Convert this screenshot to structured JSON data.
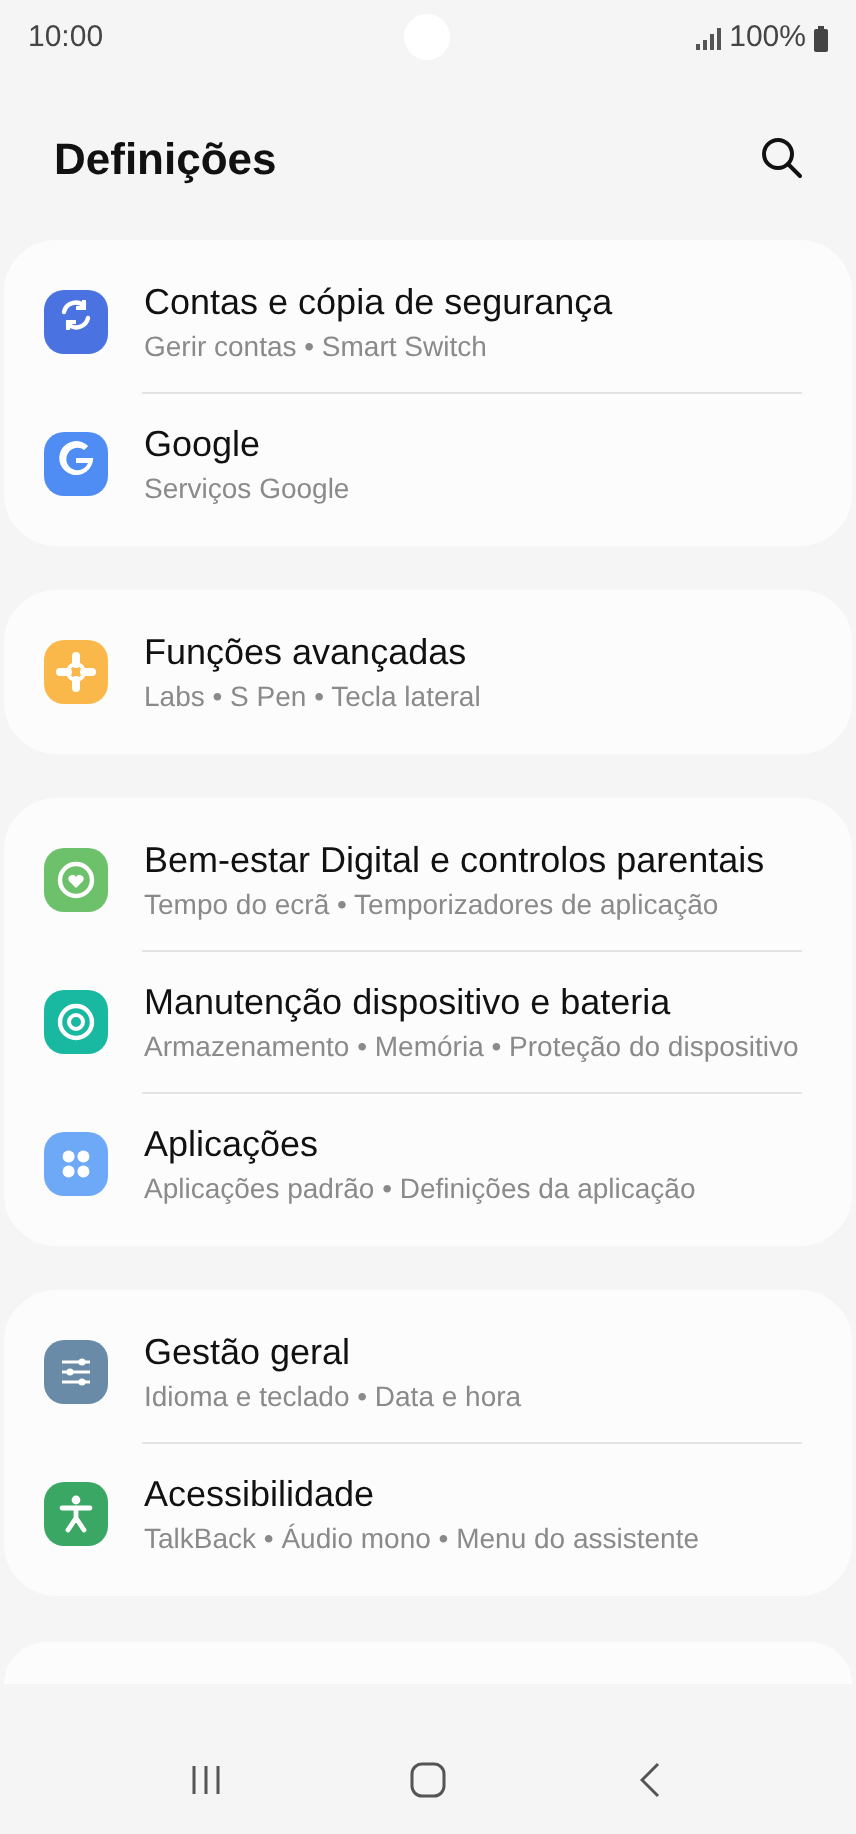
{
  "status_bar": {
    "time": "10:00",
    "battery": "100%"
  },
  "header": {
    "title": "Definições"
  },
  "groups": [
    {
      "items": [
        {
          "title": "Contas e cópia de segurança",
          "subtitle": "Gerir contas  •  Smart Switch",
          "color": "#4a72e0"
        },
        {
          "title": "Google",
          "subtitle": "Serviços Google",
          "color": "#4f8df5"
        }
      ]
    },
    {
      "items": [
        {
          "title": "Funções avançadas",
          "subtitle": "Labs  •  S Pen  •  Tecla lateral",
          "color": "#fbb84a"
        }
      ]
    },
    {
      "items": [
        {
          "title": "Bem-estar Digital e controlos parentais",
          "subtitle": "Tempo do ecrã  •  Temporizadores de aplicação",
          "color": "#6cc16a"
        },
        {
          "title": "Manutenção dispositivo e bateria",
          "subtitle": "Armazenamento  •  Memória  •  Proteção do dispositivo",
          "color": "#19b8a0"
        },
        {
          "title": "Aplicações",
          "subtitle": "Aplicações padrão  •  Definições da aplicação",
          "color": "#6ea9f7"
        }
      ]
    },
    {
      "items": [
        {
          "title": "Gestão geral",
          "subtitle": "Idioma e teclado  •  Data e hora",
          "color": "#6a8ba8"
        },
        {
          "title": "Acessibilidade",
          "subtitle": "TalkBack  •  Áudio mono  •  Menu do assistente",
          "color": "#3aa765"
        }
      ]
    }
  ]
}
